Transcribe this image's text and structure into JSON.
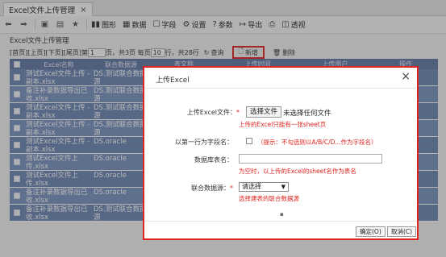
{
  "tab": {
    "title": "Excel文件上传管理",
    "close": "×"
  },
  "toolbar": {
    "nav_icons": [
      "back-icon",
      "forward-icon",
      "save-icon",
      "save-as-icon",
      "favorite-icon"
    ],
    "items": [
      {
        "icon": "▮▮",
        "label": "图形"
      },
      {
        "icon": "▦",
        "label": "数据"
      },
      {
        "icon": "☐",
        "label": "字段"
      },
      {
        "icon": "⚙",
        "label": "设置"
      },
      {
        "icon": "?",
        "label": "参数"
      },
      {
        "icon": "↦",
        "label": "导出"
      },
      {
        "icon": "⎙",
        "label": ""
      },
      {
        "icon": "◫",
        "label": "透视"
      }
    ]
  },
  "page_title": "Excel文件上传管理",
  "pager": {
    "nav": "[首页][上页][下页][尾页]",
    "page_prefix": "第",
    "page_value": "1",
    "page_mid": "页，共3页  每页",
    "per_page_value": "10",
    "per_page_suffix": "行，共28行",
    "query_label": "查询",
    "new_label": "新增",
    "delete_label": "删除"
  },
  "grid": {
    "headers": [
      "",
      "Excel名称",
      "联合数据源",
      "表文称",
      "上传时间",
      "上传用户",
      "操作"
    ],
    "rows": [
      {
        "name": "测试Excel文件上传 - 副本.xlsx",
        "ds": "DS.测试联合数据源"
      },
      {
        "name": "备注补录数据导出已收.xlsx",
        "ds": "DS.测试联合数据源"
      },
      {
        "name": "测试Excel文件上传 - 副本.xlsx",
        "ds": "DS.测试联合数据源"
      },
      {
        "name": "测试Excel文件上传 - 副本.xlsx",
        "ds": "DS.测试联合数据源"
      },
      {
        "name": "测试Excel文件上传 - 副本.xlsx",
        "ds": "DS.oracle"
      },
      {
        "name": "测试Excel文件上传.xlsx",
        "ds": "DS.oracle"
      },
      {
        "name": "测试Excel文件上传.xlsx",
        "ds": "DS.oracle"
      },
      {
        "name": "备注补录数据导出已收.xlsx",
        "ds": "DS.oracle"
      },
      {
        "name": "备注补录数据导出已收.xlsx",
        "ds": "DS.测试联合数据源"
      }
    ]
  },
  "dialog": {
    "title": "上传Excel",
    "close": "×",
    "file_label": "上传Excel文件：",
    "file_button": "选择文件",
    "file_status": "未选择任何文件",
    "file_hint": "上传的Excel只能有一张sheet页",
    "first_row_label": "以第一行为字段名：",
    "first_row_hint": "（提示：不勾选则以A/B/C/D...作为字段名）",
    "table_label": "数据库表名：",
    "table_hint": "为空时，以上传的Excel的sheet名作为表名",
    "ds_label": "联合数据源：",
    "ds_value": "请选择",
    "ds_hint": "选择建表的联合数据源",
    "ok": "确定(O)",
    "cancel": "取消(C)",
    "required_mark": "*"
  },
  "colors": {
    "accent_red": "#e0241f",
    "grid_header": "#5f77a4",
    "grid_row": "#6b86b4"
  }
}
